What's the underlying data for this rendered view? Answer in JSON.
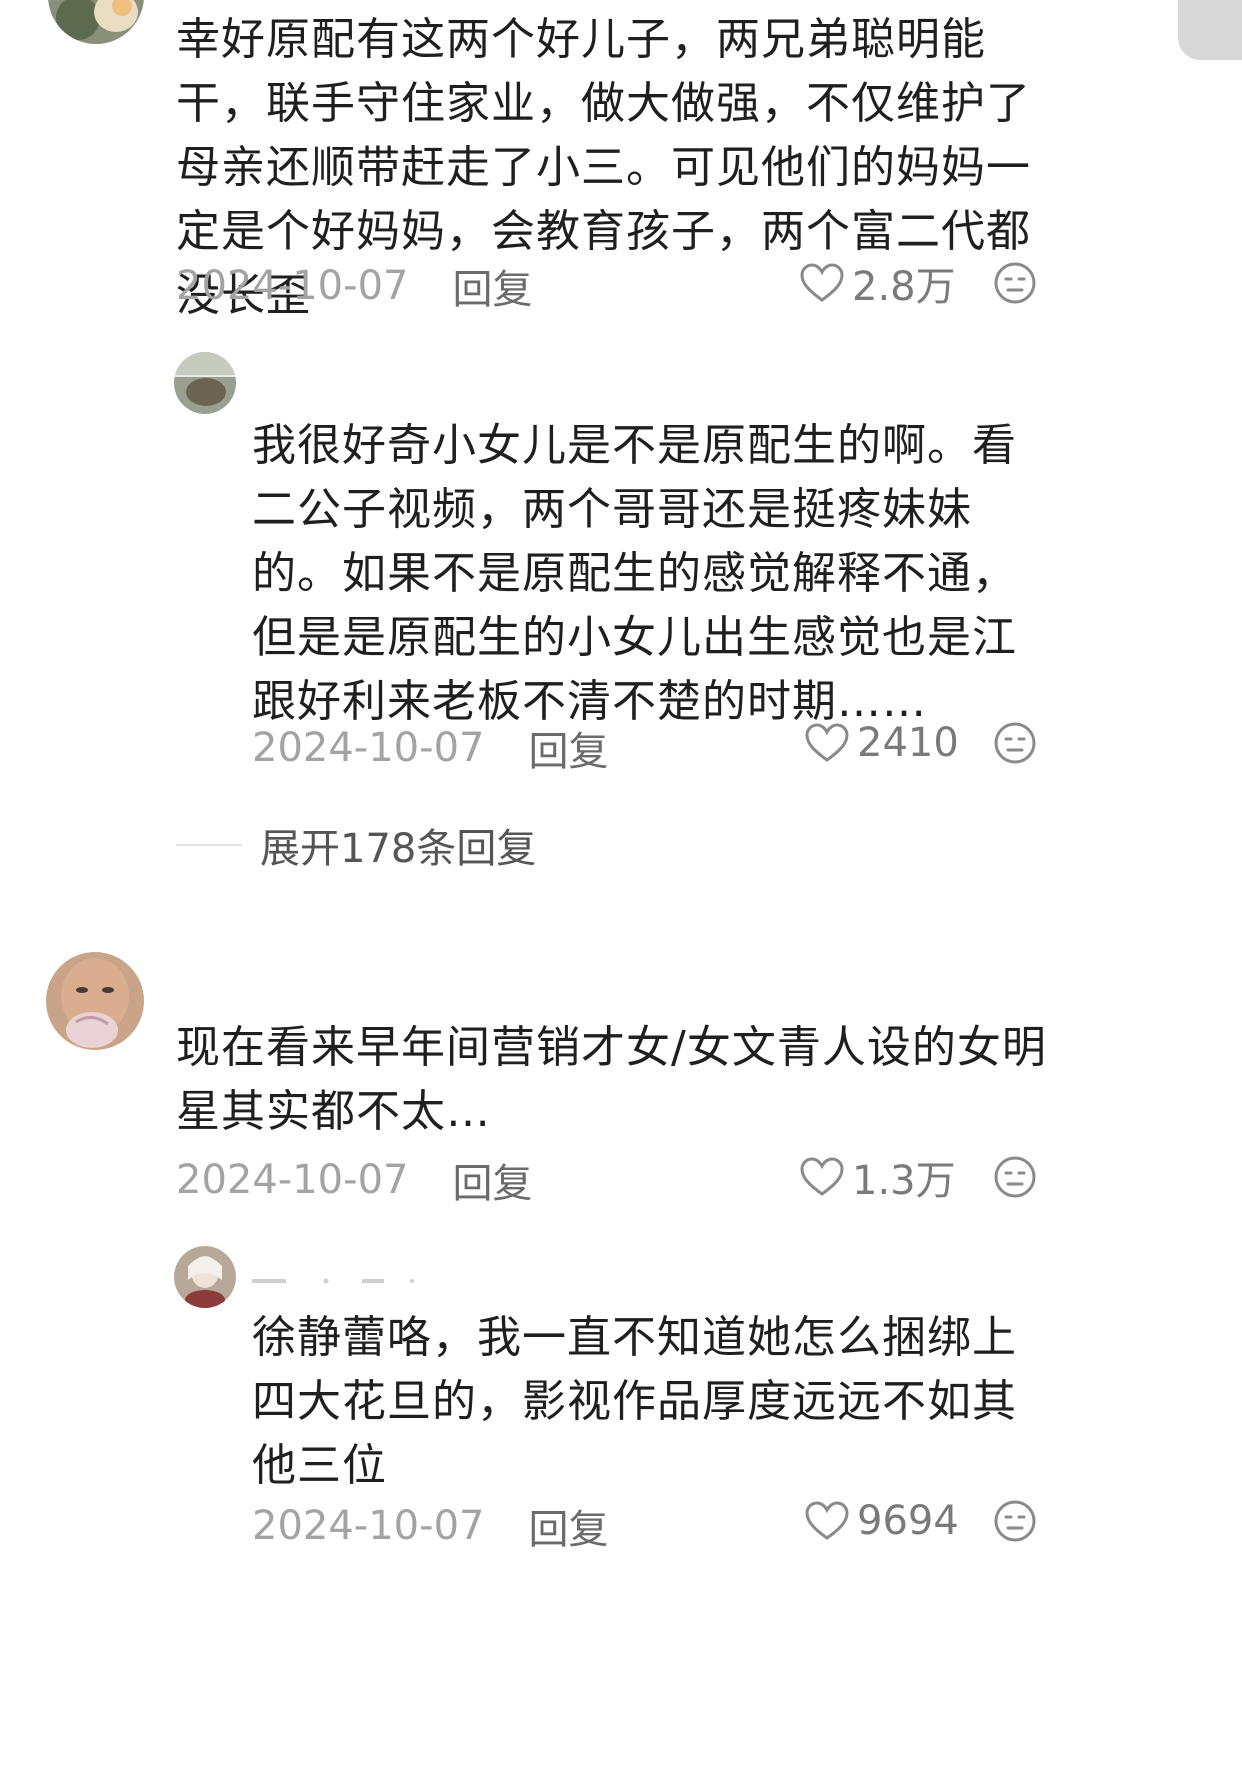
{
  "comments": [
    {
      "text": "幸好原配有这两个好儿子，两兄弟聪明能干，联手守住家业，做大做强，不仅维护了母亲还顺带赶走了小三。可见他们的妈妈一定是个好妈妈，会教育孩子，两个富二代都没长歪",
      "date": "2024-10-07",
      "reply_label": "回复",
      "likes": "2.8万",
      "replies": [
        {
          "text": "我很好奇小女儿是不是原配生的啊。看二公子视频，两个哥哥还是挺疼妹妹的。如果不是原配生的感觉解释不通，但是是原配生的小女儿出生感觉也是江跟好利来老板不清不楚的时期……",
          "date": "2024-10-07",
          "reply_label": "回复",
          "likes": "2410"
        }
      ],
      "expand_label": "展开178条回复"
    },
    {
      "text": "现在看来早年间营销才女/女文青人设的女明星其实都不太…",
      "date": "2024-10-07",
      "reply_label": "回复",
      "likes": "1.3万",
      "replies": [
        {
          "text": "徐静蕾咯，我一直不知道她怎么捆绑上四大花旦的，影视作品厚度远远不如其他三位",
          "date": "2024-10-07",
          "reply_label": "回复",
          "likes": "9694"
        }
      ]
    }
  ],
  "colors": {
    "text": "#1f1f1f",
    "date": "#a3a3a3",
    "reply": "#6b6b6b",
    "icon": "#8a8a8a"
  },
  "icons": [
    "heart-icon",
    "dislike-face-icon"
  ]
}
